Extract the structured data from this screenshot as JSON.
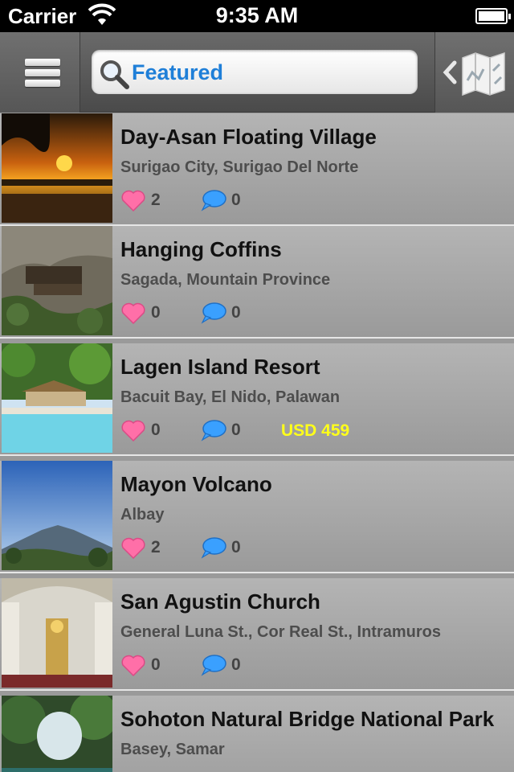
{
  "status_bar": {
    "carrier": "Carrier",
    "time": "9:35 AM"
  },
  "nav": {
    "menu_icon": "hamburger-menu-icon",
    "search_icon": "magnifier-icon",
    "search_value": "Featured",
    "map_icon": "folded-map-icon"
  },
  "colors": {
    "accent": "#1f7fd8",
    "price": "#ffff1a",
    "like": "#ff6fa8",
    "comment": "#3aa0ff"
  },
  "items": [
    {
      "title": "Day-Asan Floating Village",
      "location": "Surigao City,  Surigao Del Norte",
      "likes": "2",
      "comments": "0",
      "price": ""
    },
    {
      "title": "Hanging Coffins",
      "location": "Sagada, Mountain Province",
      "likes": "0",
      "comments": "0",
      "price": ""
    },
    {
      "title": "Lagen Island Resort",
      "location": "Bacuit Bay, El Nido, Palawan",
      "likes": "0",
      "comments": "0",
      "price": "USD 459"
    },
    {
      "title": "Mayon Volcano",
      "location": "Albay",
      "likes": "2",
      "comments": "0",
      "price": ""
    },
    {
      "title": "San Agustin Church",
      "location": "General Luna St., Cor Real St., Intramuros",
      "likes": "0",
      "comments": "0",
      "price": ""
    },
    {
      "title": "Sohoton Natural Bridge National Park",
      "location": "Basey, Samar",
      "likes": "",
      "comments": "",
      "price": ""
    }
  ]
}
